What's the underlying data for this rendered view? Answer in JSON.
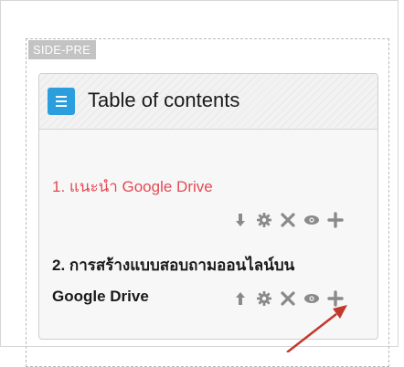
{
  "region": {
    "tag": "SIDE-PRE"
  },
  "block": {
    "title": "Table of contents",
    "icon": "list-icon",
    "accent_color": "#2b9fde"
  },
  "items": [
    {
      "text": "1. แนะนำ Google Drive",
      "color": "#e24b55",
      "actions": [
        "arrow-down-icon",
        "gear-icon",
        "delete-icon",
        "eye-icon",
        "plus-icon"
      ]
    },
    {
      "text_line1": "2. การสร้างแบบสอบถามออนไลน์บน",
      "text_line2": "Google Drive",
      "color": "#1a1a1a",
      "actions": [
        "arrow-up-icon",
        "gear-icon",
        "delete-icon",
        "eye-icon",
        "plus-icon"
      ]
    }
  ],
  "annotation": {
    "arrow_color": "#c0392b",
    "target": "plus-icon"
  }
}
